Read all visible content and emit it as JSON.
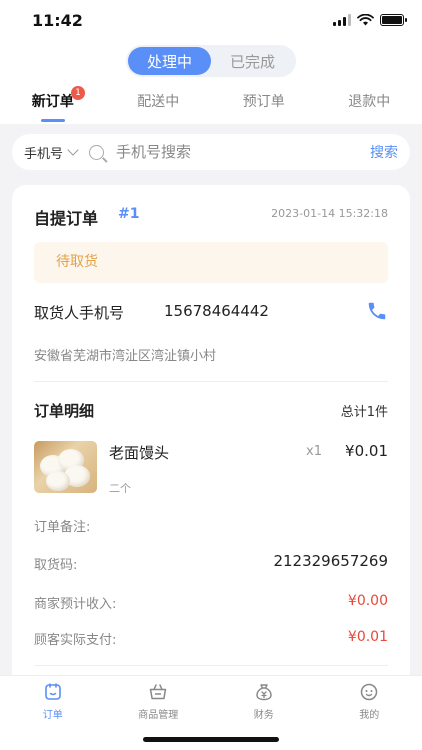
{
  "status_bar": {
    "time": "11:42"
  },
  "segment": {
    "items": [
      "处理中",
      "已完成"
    ],
    "active_index": 0
  },
  "tabs": [
    {
      "label": "新订单",
      "badge": "1"
    },
    {
      "label": "配送中"
    },
    {
      "label": "预订单"
    },
    {
      "label": "退款中"
    }
  ],
  "search": {
    "type_label": "手机号",
    "placeholder": "手机号搜索",
    "button": "搜索"
  },
  "order": {
    "title": "自提订单",
    "number": "#1",
    "time": "2023-01-14 15:32:18",
    "status": "待取货",
    "pickup_label": "取货人手机号",
    "pickup_phone": "15678464442",
    "address": "安徽省芜湖市湾沚区湾沚镇小村",
    "detail_title": "订单明细",
    "detail_total": "总计1件",
    "product": {
      "name": "老面馒头",
      "qty": "x1",
      "price": "¥0.01",
      "spec": "二个"
    },
    "rows": {
      "remark_label": "订单备注:",
      "pickup_code_label": "取货码:",
      "pickup_code_value": "212329657269",
      "merchant_income_label": "商家预计收入:",
      "merchant_income_value": "¥0.00",
      "customer_paid_label": "顾客实际支付:",
      "customer_paid_value": "¥0.01"
    }
  },
  "tabbar": [
    {
      "label": "订单",
      "icon": "order-icon"
    },
    {
      "label": "商品管理",
      "icon": "basket-icon"
    },
    {
      "label": "财务",
      "icon": "money-bag-icon"
    },
    {
      "label": "我的",
      "icon": "profile-face-icon"
    }
  ],
  "colors": {
    "accent": "#5a8ff7",
    "warning_text": "#e3a24a",
    "warning_bg": "#fdf6ec",
    "price_red": "#e8473b",
    "badge": "#ee5a4a"
  }
}
